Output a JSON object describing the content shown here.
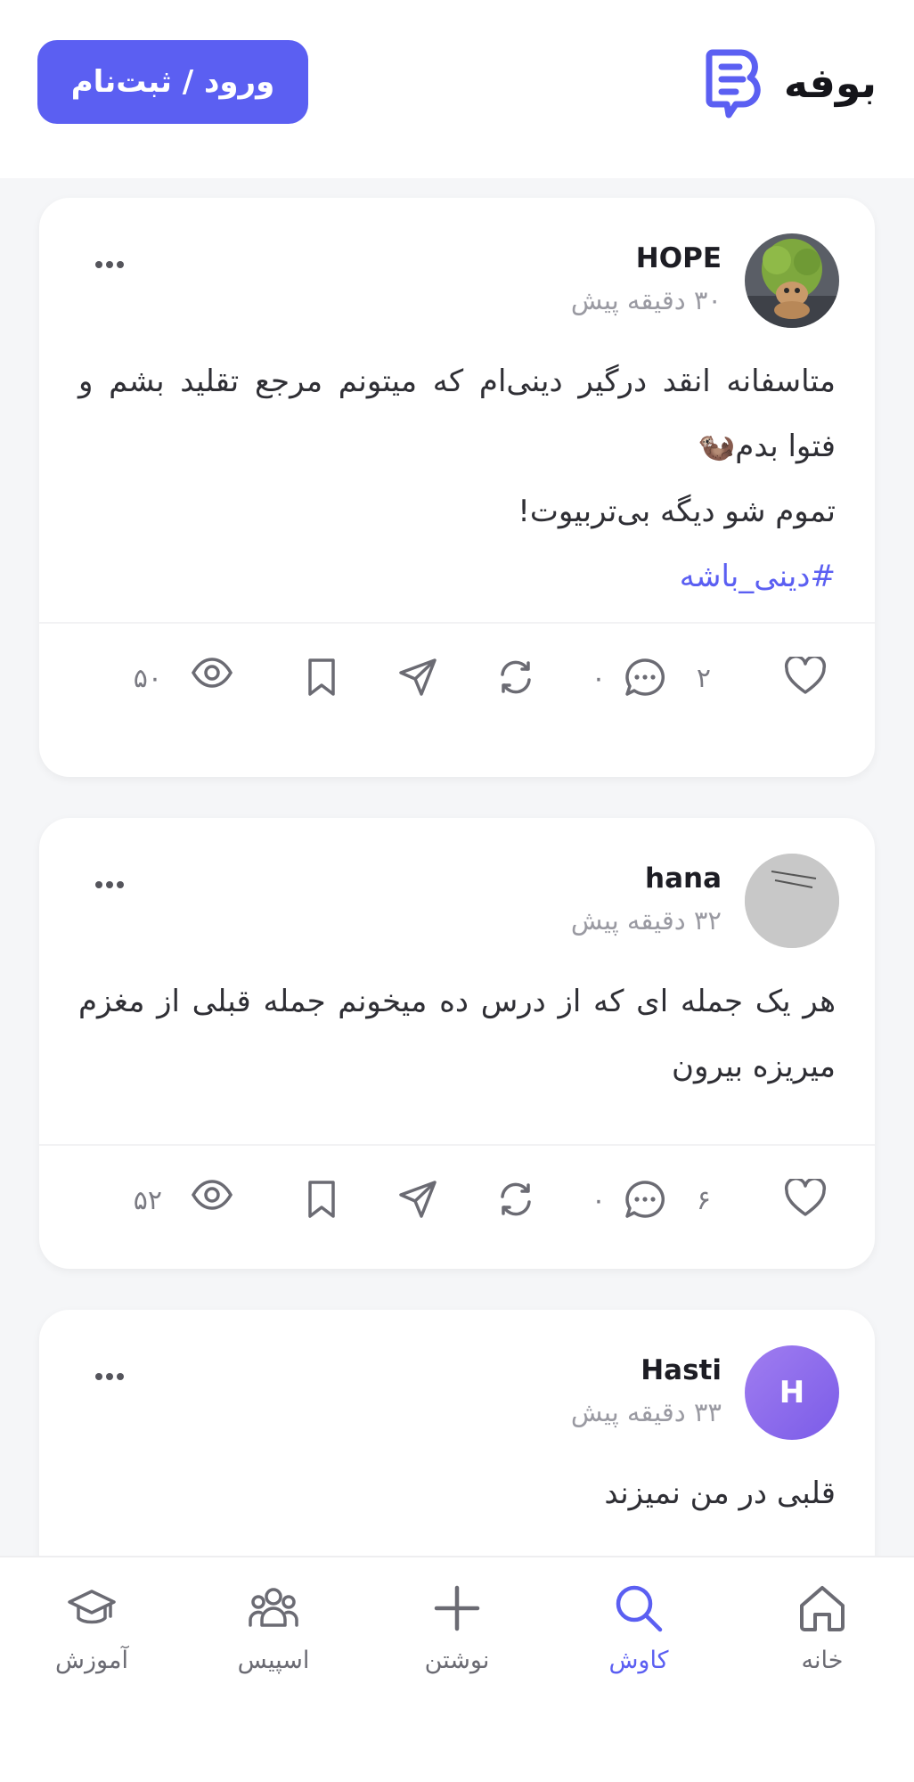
{
  "header": {
    "brand_name": "بوفه",
    "login_label": "ورود / ثبت‌نام",
    "brand_color": "#5b5ff2"
  },
  "posts": [
    {
      "author": "HOPE",
      "time": "۳۰ دقیقه پیش",
      "lines": [
        "متاسفانه انقد درگیر دینی‌ام که میتونم مرجع تقلید بشم و فتوا بدم🦦",
        "تموم شو دیگه بی‌تربیوت!"
      ],
      "hashtag": "#دینی_باشه",
      "likes": "۲",
      "comments": "۰",
      "views": "۵۰"
    },
    {
      "author": "hana",
      "time": "۳۲ دقیقه پیش",
      "lines": [
        "هر یک جمله ای که از درس ده میخونم  جمله قبلی از مغزم میریزه بیرون"
      ],
      "likes": "۶",
      "comments": "۰",
      "views": "۵۲"
    },
    {
      "author": "Hasti",
      "time": "۳۳ دقیقه پیش",
      "avatar_letter": "H",
      "lines": [
        "قلبی در من نمیزند"
      ]
    }
  ],
  "nav": {
    "items": [
      {
        "label": "خانه",
        "icon": "home-icon"
      },
      {
        "label": "کاوش",
        "icon": "search-icon",
        "active": true
      },
      {
        "label": "نوشتن",
        "icon": "plus-icon"
      },
      {
        "label": "اسپیس",
        "icon": "users-icon"
      },
      {
        "label": "آموزش",
        "icon": "graduation-cap-icon"
      }
    ]
  }
}
